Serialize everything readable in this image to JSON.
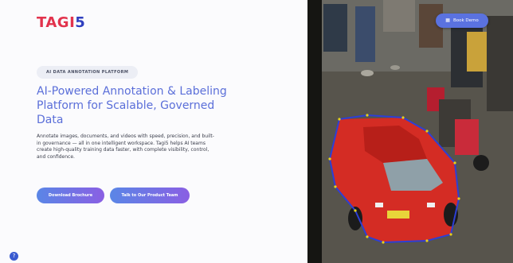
{
  "brand": {
    "logo_part1": "TAGI",
    "logo_part2": "5"
  },
  "hero": {
    "eyebrow": "AI DATA ANNOTATION PLATFORM",
    "headline": "AI-Powered Annotation & Labeling Platform for Scalable, Governed Data",
    "description": "Annotate images, documents, and videos with speed, precision, and built-in governance — all in one intelligent workspace. Tagi5 helps AI teams create high-quality training data faster, with complete visibility, control, and confidence.",
    "primary_cta": "Download Brochure",
    "secondary_cta": "Talk to Our Product Team"
  },
  "header": {
    "book_demo_label": "Book Demo",
    "book_demo_icon": "calendar-icon"
  },
  "widgets": {
    "help_icon": "chat-help-icon",
    "help_glyph": "?"
  },
  "colors": {
    "brand_red": "#e2334d",
    "brand_blue": "#2f3fbf",
    "headline": "#5b6fd9",
    "button_gradient_start": "#5a86e6",
    "button_gradient_end": "#8a5fe3",
    "annotation_outline": "#2d3fd6",
    "annotation_points": "#e6d21a"
  },
  "image": {
    "subject": "red sedan with polygon annotation in a street market"
  }
}
